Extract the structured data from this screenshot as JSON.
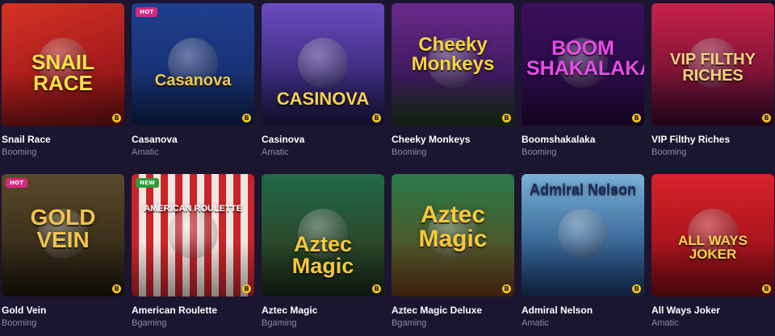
{
  "games": [
    {
      "name": "Snail Race",
      "provider": "Booming",
      "badge": "",
      "art_title": "SNAIL RACE",
      "bg": "linear-gradient(160deg,#d63324 0%,#a91c1c 55%,#6e1010 100%)",
      "art_color": "#ffe14a",
      "icon": "snail-icon"
    },
    {
      "name": "Casanova",
      "provider": "Amatic",
      "badge": "HOT",
      "art_title": "Casanova",
      "bg": "linear-gradient(180deg,#1e3f8f 0%,#173173 60%,#0f2250 100%)",
      "art_color": "#f4c94a",
      "icon": "portrait-icon"
    },
    {
      "name": "Casinova",
      "provider": "Amatic",
      "badge": "",
      "art_title": "CASINOVA",
      "bg": "linear-gradient(180deg,#6b4cc0 0%,#3b2a7a 60%,#1f1a4a 100%)",
      "art_color": "#f6d14c",
      "icon": "portrait-icon"
    },
    {
      "name": "Cheeky Monkeys",
      "provider": "Booming",
      "badge": "",
      "art_title": "Cheeky Monkeys",
      "bg": "linear-gradient(180deg,#6a2a8c 0%,#3e1a5e 60%,#1e3a1a 100%)",
      "art_color": "#f4d33a",
      "icon": "monkey-icon"
    },
    {
      "name": "Boomshakalaka",
      "provider": "Booming",
      "badge": "",
      "art_title": "BOOM SHAKALAKA",
      "bg": "linear-gradient(180deg,#3a0f5c 0%,#22093a 100%)",
      "art_color": "#e94be8",
      "icon": "burst-icon"
    },
    {
      "name": "VIP Filthy Riches",
      "provider": "Booming",
      "badge": "",
      "art_title": "VIP FILTHY RICHES",
      "bg": "linear-gradient(180deg,#c8224a 0%,#8a1538 50%,#3a0a2a 100%)",
      "art_color": "#f2d27a",
      "icon": "palm-icon"
    },
    {
      "name": "Gold Vein",
      "provider": "Booming",
      "badge": "HOT",
      "art_title": "GOLD VEIN",
      "bg": "linear-gradient(180deg,#5a4a2a 0%,#3a2e1a 60%,#1e170c 100%)",
      "art_color": "#f2c34a",
      "icon": "mine-icon"
    },
    {
      "name": "American Roulette",
      "provider": "Bgaming",
      "badge": "NEW",
      "art_title": "AMERICAN ROULETTE",
      "bg": "repeating-linear-gradient(90deg,#c8242a 0 9px,#f2e6e0 9px 18px)",
      "art_color": "#ffffff",
      "icon": "roulette-icon"
    },
    {
      "name": "Aztec Magic",
      "provider": "Bgaming",
      "badge": "",
      "art_title": "Aztec Magic",
      "bg": "linear-gradient(180deg,#1f6a4a 0%,#2a4a2a 55%,#1a2a1a 100%)",
      "art_color": "#f6c83a",
      "icon": "portrait-icon"
    },
    {
      "name": "Aztec Magic Deluxe",
      "provider": "Bgaming",
      "badge": "",
      "art_title": "Aztec Magic",
      "bg": "linear-gradient(180deg,#2a7a4a 0%,#4a5a2a 55%,#6a3a1a 100%)",
      "art_color": "#f6c83a",
      "icon": "portrait-icon"
    },
    {
      "name": "Admiral Nelson",
      "provider": "Amatic",
      "badge": "",
      "art_title": "Admiral Nelson",
      "bg": "linear-gradient(180deg,#7ab0d8 0%,#3a6a9a 55%,#1a3a6a 100%)",
      "art_color": "#1c2a5a",
      "icon": "portrait-icon"
    },
    {
      "name": "All Ways Joker",
      "provider": "Amatic",
      "badge": "",
      "art_title": "ALL WAYS JOKER",
      "bg": "linear-gradient(180deg,#d8222a 0%,#a8141c 60%,#7a0c14 100%)",
      "art_color": "#f6d24a",
      "icon": "joker-icon"
    }
  ],
  "coin_symbol": "B"
}
